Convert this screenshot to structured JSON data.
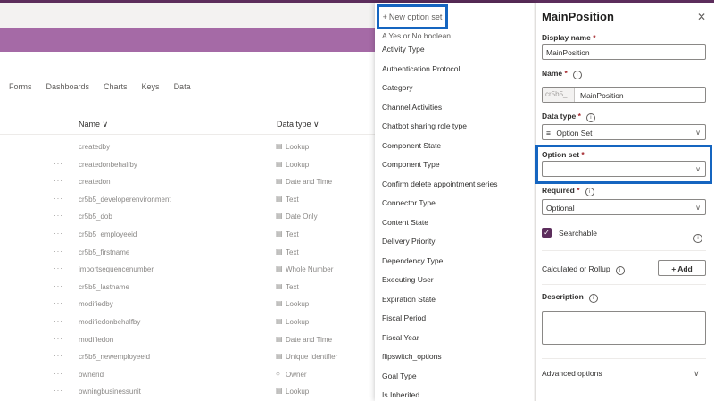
{
  "toolbar": {
    "new_option_set_label": "New option set"
  },
  "tabs": [
    "Forms",
    "Dashboards",
    "Charts",
    "Keys",
    "Data"
  ],
  "table": {
    "columns": [
      "Name ∨",
      "Data type ∨"
    ],
    "rows": [
      {
        "name": "createdby",
        "type": "Lookup",
        "icon": "▤"
      },
      {
        "name": "createdonbehalfby",
        "type": "Lookup",
        "icon": "▤"
      },
      {
        "name": "createdon",
        "type": "Date and Time",
        "icon": "▤"
      },
      {
        "name": "cr5b5_developerenvironment",
        "type": "Text",
        "icon": "▤"
      },
      {
        "name": "cr5b5_dob",
        "type": "Date Only",
        "icon": "▤"
      },
      {
        "name": "cr5b5_employeeid",
        "type": "Text",
        "icon": "▤"
      },
      {
        "name": "cr5b5_firstname",
        "type": "Text",
        "icon": "▤"
      },
      {
        "name": "importsequencenumber",
        "type": "Whole Number",
        "icon": "▤"
      },
      {
        "name": "cr5b5_lastname",
        "type": "Text",
        "icon": "▤"
      },
      {
        "name": "modifiedby",
        "type": "Lookup",
        "icon": "▤"
      },
      {
        "name": "modifiedonbehalfby",
        "type": "Lookup",
        "icon": "▤"
      },
      {
        "name": "modifiedon",
        "type": "Date and Time",
        "icon": "▤"
      },
      {
        "name": "cr5b5_newemployeeid",
        "type": "Unique Identifier",
        "icon": "▤"
      },
      {
        "name": "ownerid",
        "type": "Owner",
        "icon": "○"
      },
      {
        "name": "owningbusinessunit",
        "type": "Lookup",
        "icon": "▤"
      }
    ]
  },
  "option_sets": [
    "A Yes or No boolean",
    "Activity Type",
    "Authentication Protocol",
    "Category",
    "Channel Activities",
    "Chatbot sharing role type",
    "Component State",
    "Component Type",
    "Confirm delete appointment series",
    "Connector Type",
    "Content State",
    "Delivery Priority",
    "Dependency Type",
    "Executing User",
    "Expiration State",
    "Fiscal Period",
    "Fiscal Year",
    "flipswitch_options",
    "Goal Type",
    "Is Inherited"
  ],
  "panel": {
    "title": "MainPosition",
    "display_name_label": "Display name",
    "display_name_value": "MainPosition",
    "name_label": "Name",
    "name_prefix": "cr5b5_",
    "name_value": "MainPosition",
    "data_type_label": "Data type",
    "data_type_value": "Option Set",
    "option_set_label": "Option set",
    "option_set_value": "",
    "required_label": "Required",
    "required_value": "Optional",
    "searchable_label": "Searchable",
    "calculated_label": "Calculated or Rollup",
    "add_label": "+ Add",
    "description_label": "Description",
    "advanced_label": "Advanced options",
    "required_mark": "*"
  },
  "colors": {
    "brand_purple": "#a56aa6",
    "dark_purple": "#5c2d5c",
    "highlight": "#1565c0"
  }
}
